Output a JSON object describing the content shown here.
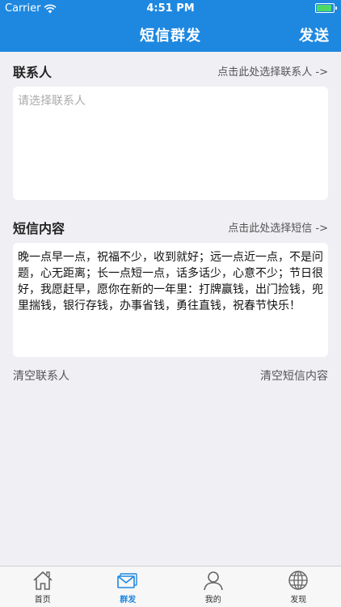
{
  "status_bar": {
    "carrier": "Carrier",
    "time": "4:51 PM",
    "battery_level": 0.9
  },
  "nav": {
    "title": "短信群发",
    "send_label": "发送"
  },
  "contacts": {
    "title": "联系人",
    "select_link": "点击此处选择联系人 ->",
    "placeholder": "请选择联系人"
  },
  "message": {
    "title": "短信内容",
    "select_link": "点击此处选择短信 ->",
    "content": "晚一点早一点，祝福不少，收到就好；远一点近一点，不是问题，心无距离；长一点短一点，话多话少，心意不少；节日很好，我愿赶早，愿你在新的一年里：打牌赢钱，出门捡钱，兜里揣钱，银行存钱，办事省钱，勇往直钱，祝春节快乐！"
  },
  "actions": {
    "clear_contacts": "清空联系人",
    "clear_message": "清空短信内容"
  },
  "tabs": [
    {
      "label": "首页",
      "icon": "home-icon",
      "active": false
    },
    {
      "label": "群发",
      "icon": "mail-icon",
      "active": true
    },
    {
      "label": "我的",
      "icon": "user-icon",
      "active": false
    },
    {
      "label": "发现",
      "icon": "globe-icon",
      "active": false
    }
  ],
  "colors": {
    "accent": "#1e88e0",
    "battery": "#4cd964"
  }
}
